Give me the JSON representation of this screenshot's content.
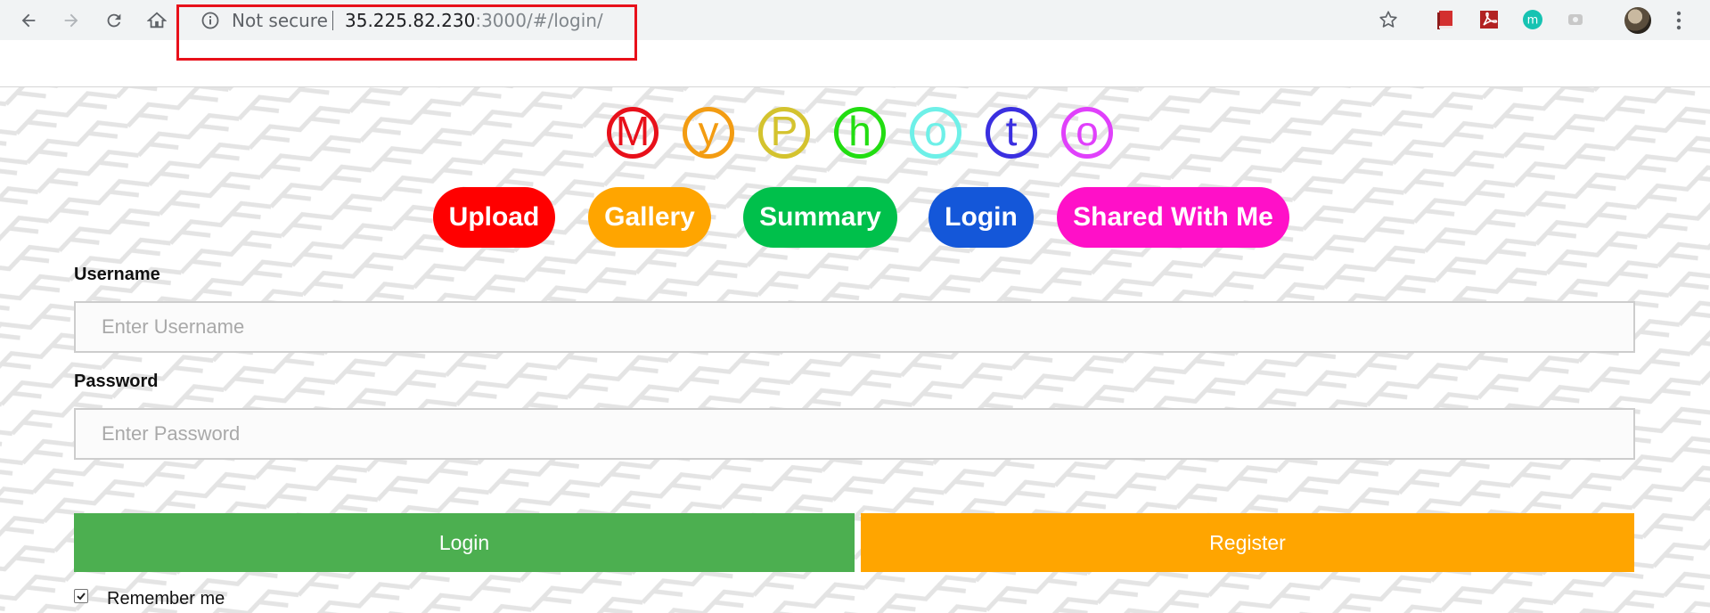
{
  "browser": {
    "security_label": "Not secure",
    "url_host": "35.225.82.230",
    "url_path": ":3000/#/login/",
    "toolbar_icons": [
      "back-arrow-icon",
      "forward-arrow-icon",
      "reload-icon",
      "home-icon",
      "info-icon",
      "bookmark-star-icon",
      "book-extension-icon",
      "pdf-extension-icon",
      "m-extension-icon",
      "grey-extension-icon",
      "profile-avatar",
      "kebab-menu-icon"
    ],
    "ext_m_letter": "m"
  },
  "logo": {
    "letters": [
      {
        "char": "M",
        "color": "#e8101a"
      },
      {
        "char": "y",
        "color": "#f39c12"
      },
      {
        "char": "P",
        "color": "#d4c32e"
      },
      {
        "char": "h",
        "color": "#22dd11"
      },
      {
        "char": "o",
        "color": "#6ef0e8"
      },
      {
        "char": "t",
        "color": "#3a2fe0"
      },
      {
        "char": "o",
        "color": "#e040fb"
      }
    ]
  },
  "nav": {
    "upload": {
      "label": "Upload",
      "color": "#ff0000"
    },
    "gallery": {
      "label": "Gallery",
      "color": "#ffa500"
    },
    "summary": {
      "label": "Summary",
      "color": "#00c04b"
    },
    "login": {
      "label": "Login",
      "color": "#1457d9"
    },
    "shared": {
      "label": "Shared With Me",
      "color": "#ff10c8"
    }
  },
  "form": {
    "username_label": "Username",
    "username_placeholder": "Enter Username",
    "password_label": "Password",
    "password_placeholder": "Enter Password",
    "login_button": "Login",
    "register_button": "Register",
    "remember_label": "Remember me",
    "remember_checked": true
  },
  "colors": {
    "login_green": "#4caf50",
    "register_orange": "#ffa500",
    "highlight_red": "#e8101a"
  }
}
